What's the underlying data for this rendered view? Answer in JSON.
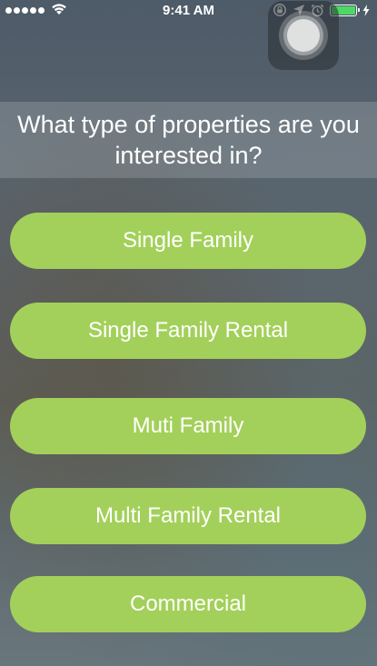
{
  "status_bar": {
    "time": "9:41 AM",
    "signal_bars": 5,
    "battery_level": 1.0,
    "battery_color": "#4cd964",
    "icons": [
      "signal-dots-icon",
      "wifi-icon",
      "rotation-lock-icon",
      "location-arrow-icon",
      "alarm-icon",
      "battery-icon",
      "charging-bolt-icon"
    ]
  },
  "question": {
    "text": "What type of properties are you interested in?"
  },
  "options": [
    {
      "label": "Single Family"
    },
    {
      "label": "Single Family Rental"
    },
    {
      "label": "Muti Family"
    },
    {
      "label": "Multi Family Rental"
    },
    {
      "label": "Commercial"
    }
  ],
  "colors": {
    "option_button": "#a3d05a",
    "text": "#ffffff"
  }
}
